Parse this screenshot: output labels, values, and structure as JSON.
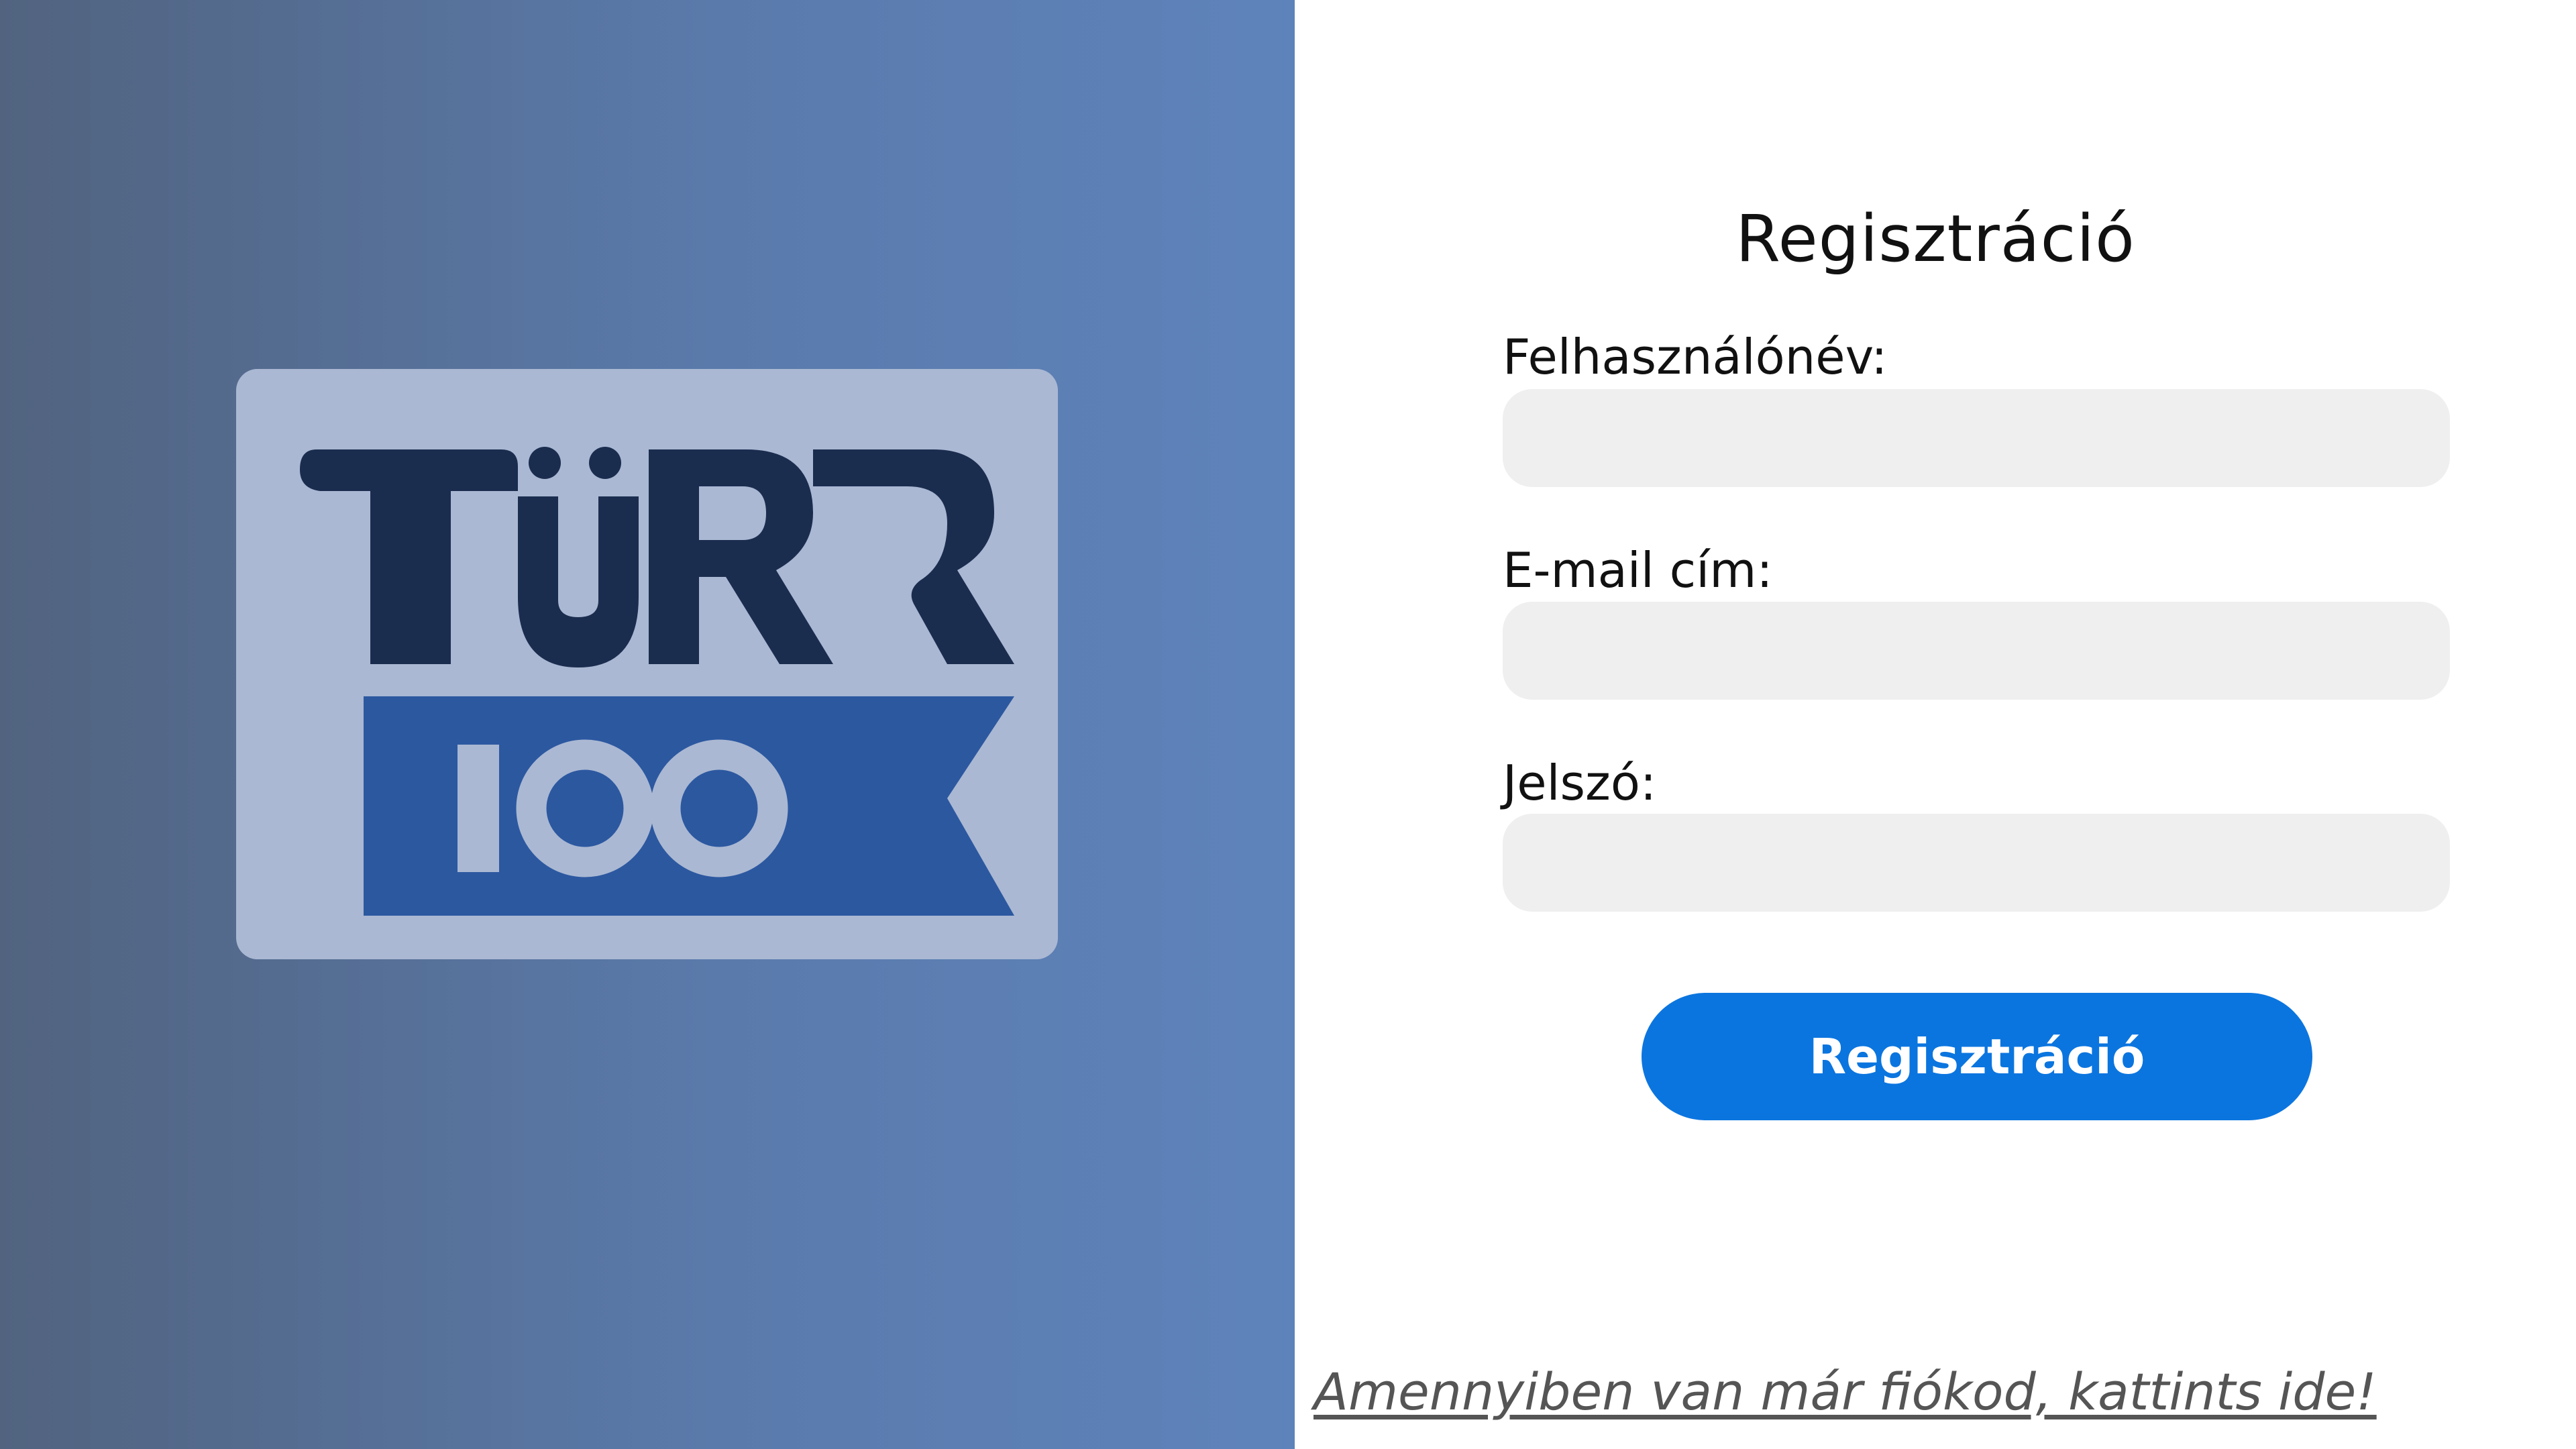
{
  "brand": {
    "logo_text": "TÜRR",
    "logo_number": "100",
    "colors": {
      "logo_dark": "#1b2d4f",
      "logo_blue": "#2c58a0",
      "logo_card": "#aab8d3",
      "button": "#0b75df"
    }
  },
  "form": {
    "title": "Regisztráció",
    "username_label": "Felhasználónév:",
    "username_value": "",
    "email_label": "E-mail cím:",
    "email_value": "",
    "password_label": "Jelszó:",
    "password_value": "",
    "submit_label": "Regisztráció"
  },
  "footer": {
    "login_link": "Amennyiben van már fiókod, kattints ide!"
  }
}
